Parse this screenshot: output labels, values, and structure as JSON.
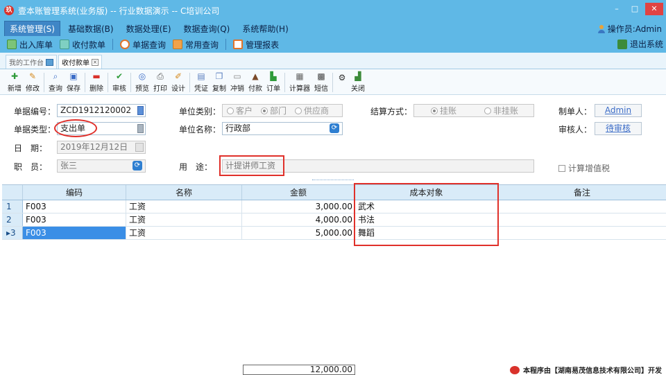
{
  "window": {
    "title": "壹本账管理系统(业务版) -- 行业数据演示 -- C培训公司",
    "minimize": "–",
    "maximize": "□",
    "close": "✕"
  },
  "menu": {
    "items": [
      "系统管理(S)",
      "基础数据(B)",
      "数据处理(E)",
      "数据查询(Q)",
      "系统帮助(H)"
    ],
    "operator": "操作员:Admin"
  },
  "quickbar": {
    "items": [
      "出入库单",
      "收付款单",
      "单据查询",
      "常用查询",
      "管理报表"
    ],
    "exit": "退出系统"
  },
  "tabs": [
    {
      "label": "我的工作台",
      "active": false
    },
    {
      "label": "收付款单",
      "active": true
    }
  ],
  "toolbar": [
    "新增",
    "修改",
    "查询",
    "保存",
    "删除",
    "审核",
    "预览",
    "打印",
    "设计",
    "凭证",
    "复制",
    "冲销",
    "付款",
    "订单",
    "计算器",
    "短信",
    "关闭"
  ],
  "form": {
    "doc_no_label": "单据编号：",
    "doc_no": "ZCD1912120002",
    "doc_type_label": "单据类型：",
    "doc_type": "支出单",
    "date_label": "日　期：",
    "date": "2019年12月12日",
    "staff_label": "职　员：",
    "staff": "张三",
    "unit_type_label": "单位类别：",
    "unit_types": [
      "客户",
      "部门",
      "供应商"
    ],
    "unit_type_selected": 1,
    "unit_name_label": "单位名称：",
    "unit_name": "行政部",
    "purpose_label": "用　途：",
    "purpose": "计提讲师工资",
    "settle_label": "结算方式：",
    "settle_options": [
      "挂账",
      "非挂账"
    ],
    "settle_selected": 0,
    "maker_label": "制单人：",
    "maker": "Admin",
    "auditor_label": "审核人：",
    "auditor": "待审核",
    "vat_label": "计算增值税"
  },
  "grid": {
    "columns": [
      "编码",
      "名称",
      "金额",
      "成本对象",
      "备注"
    ],
    "rows": [
      {
        "no": "1",
        "code": "F003",
        "name": "工资",
        "amount": "3,000.00",
        "cost": "武术",
        "note": ""
      },
      {
        "no": "2",
        "code": "F003",
        "name": "工资",
        "amount": "4,000.00",
        "cost": "书法",
        "note": ""
      },
      {
        "no": "3",
        "code": "F003",
        "name": "工资",
        "amount": "5,000.00",
        "cost": "舞蹈",
        "note": ""
      }
    ],
    "selected_row": 2,
    "total": "12,000.00"
  },
  "footer": {
    "brand": "本程序由【湖南易茂信息技术有限公司】开发"
  },
  "colors": {
    "chrome": "#5fb8e6",
    "highlight": "#3a8ee6",
    "annotation": "#e0302a"
  },
  "icons": {
    "app": "app-logo-icon",
    "user": "user-icon",
    "refresh": "refresh-icon",
    "dropdown": "dropdown-icon"
  }
}
